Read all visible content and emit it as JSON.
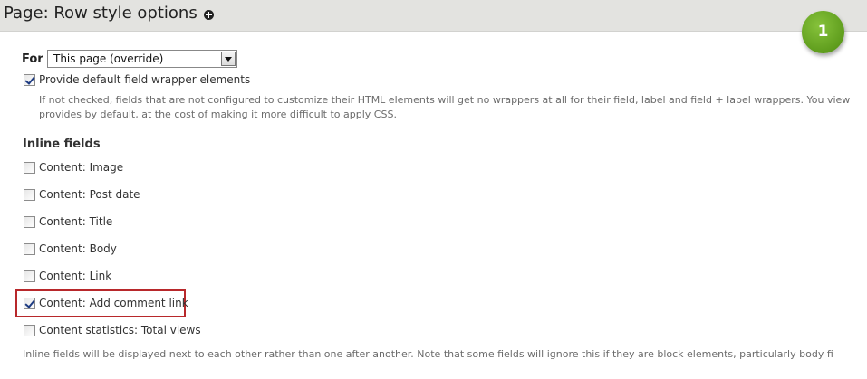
{
  "page": {
    "title": "Page: Row style options",
    "step_badge": "1"
  },
  "for_field": {
    "label": "For",
    "selected": "This page (override)"
  },
  "wrapper_option": {
    "label": "Provide default field wrapper elements",
    "checked": true,
    "description": "If not checked, fields that are not configured to customize their HTML elements will get no wrappers at all for their field, label and field + label wrappers. You view provides by default, at the cost of making it more difficult to apply CSS."
  },
  "inline_fields": {
    "title": "Inline fields",
    "items": [
      {
        "label": "Content: Image",
        "checked": false
      },
      {
        "label": "Content: Post date",
        "checked": false
      },
      {
        "label": "Content: Title",
        "checked": false
      },
      {
        "label": "Content: Body",
        "checked": false
      },
      {
        "label": "Content: Link",
        "checked": false
      },
      {
        "label": "Content: Add comment link",
        "checked": true
      },
      {
        "label": "Content statistics: Total views",
        "checked": false
      }
    ],
    "description": "Inline fields will be displayed next to each other rather than one after another. Note that some fields will ignore this if they are block elements, particularly body fi"
  },
  "colors": {
    "titlebar": "#e3e3e0",
    "badge": "#5f9d1d",
    "highlight": "#b8282b"
  }
}
